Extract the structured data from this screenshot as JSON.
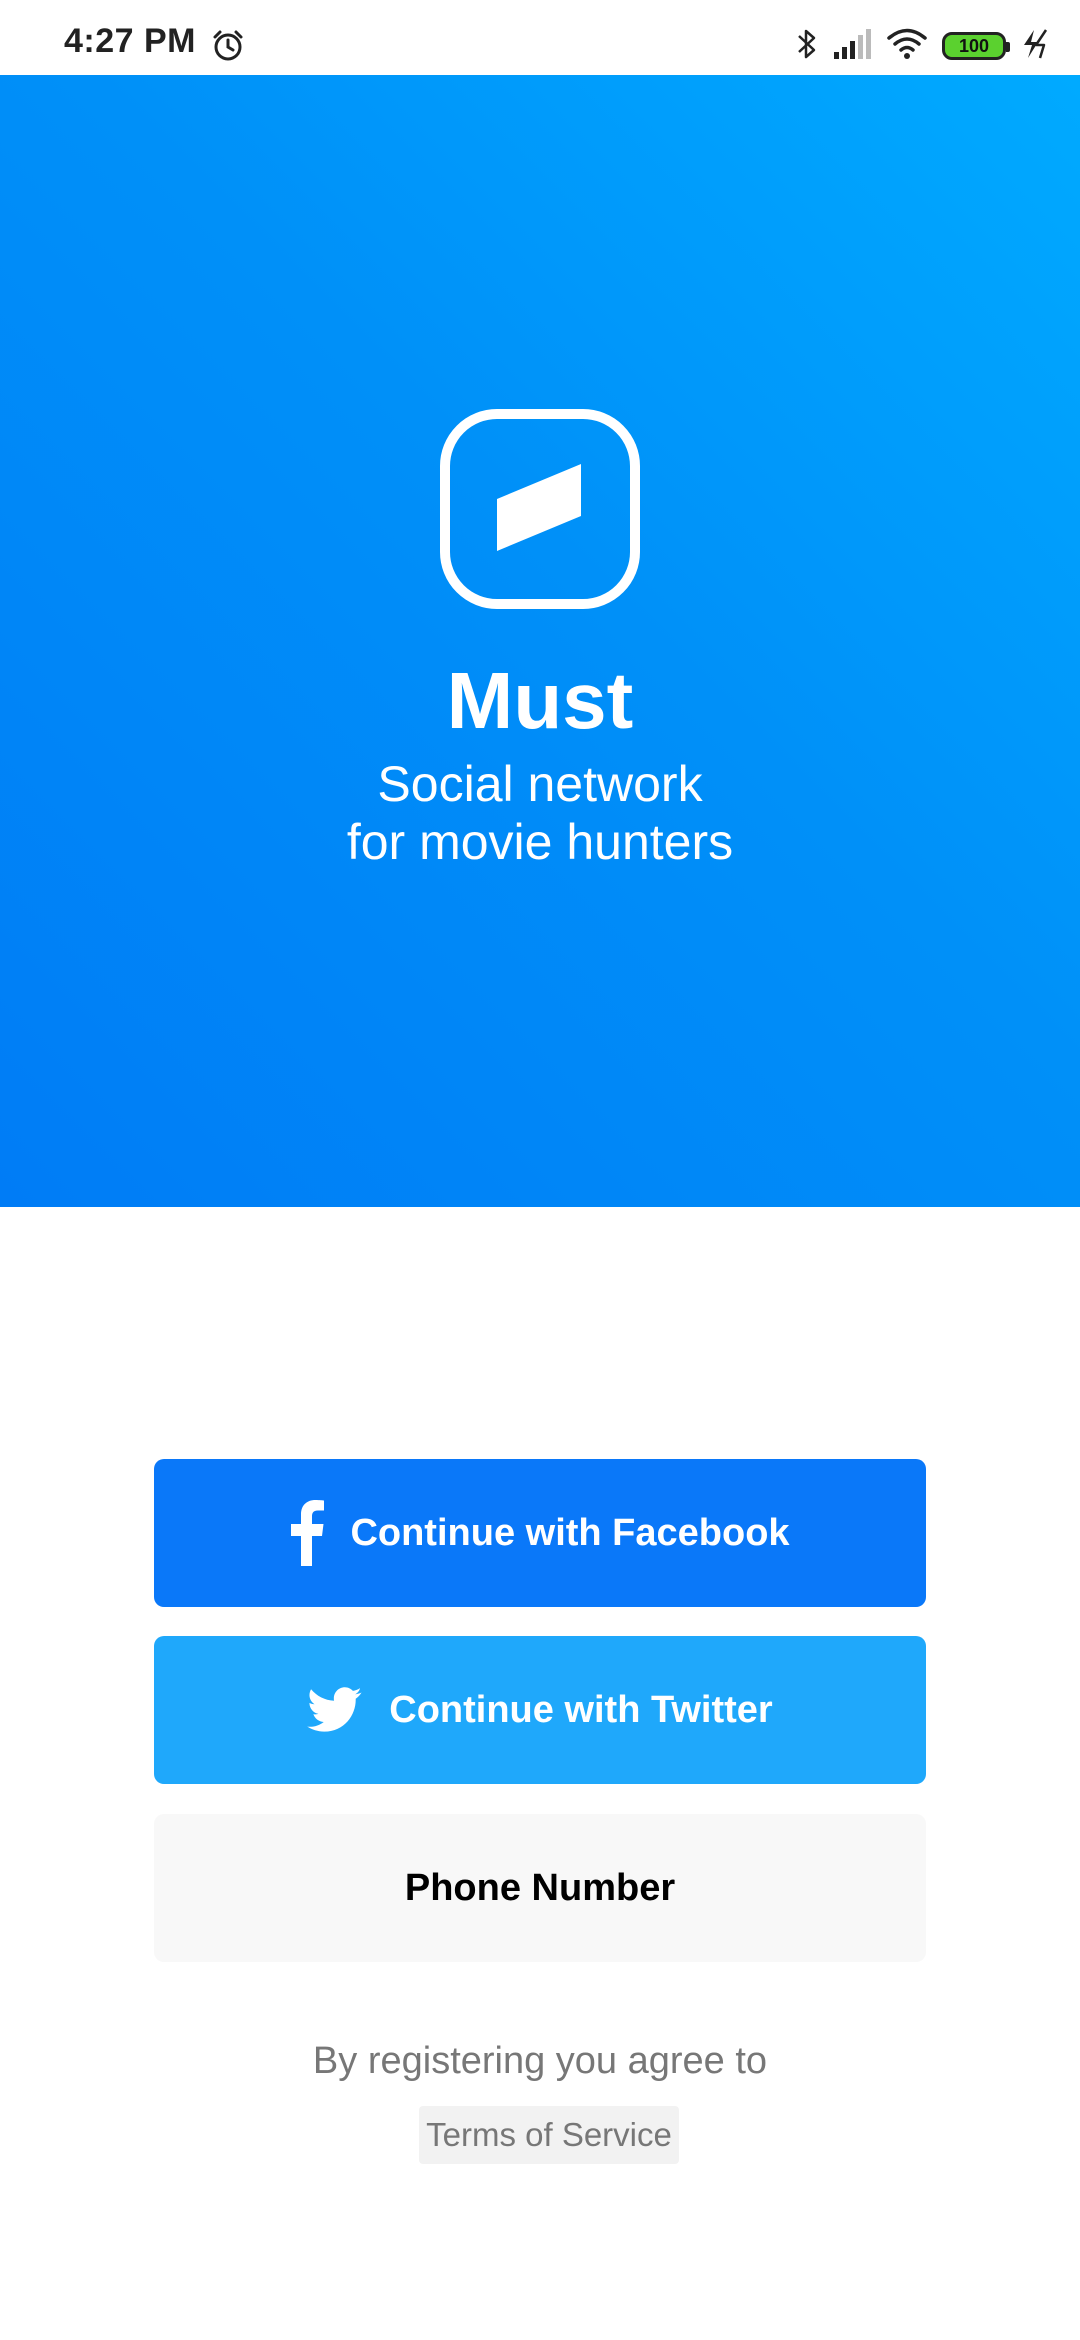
{
  "status_bar": {
    "time": "4:27 PM",
    "battery": "100",
    "icons": [
      "alarm-icon",
      "bluetooth-icon",
      "signal-icon",
      "wifi-icon",
      "battery-icon",
      "charging-icon"
    ]
  },
  "hero": {
    "app_name": "Must",
    "tagline_line1": "Social network",
    "tagline_line2": "for movie hunters",
    "logo_icon": "must-logo-icon"
  },
  "auth": {
    "facebook_label": "Continue with Facebook",
    "twitter_label": "Continue with Twitter",
    "phone_label": "Phone Number"
  },
  "legal": {
    "agree_text": "By registering you agree to",
    "terms_label": "Terms of Service"
  },
  "colors": {
    "hero_gradient_start": "#00aaff",
    "hero_gradient_end": "#007cf6",
    "facebook": "#0a78f9",
    "twitter": "#1fa8fb",
    "phone_bg": "#f8f8f8"
  }
}
